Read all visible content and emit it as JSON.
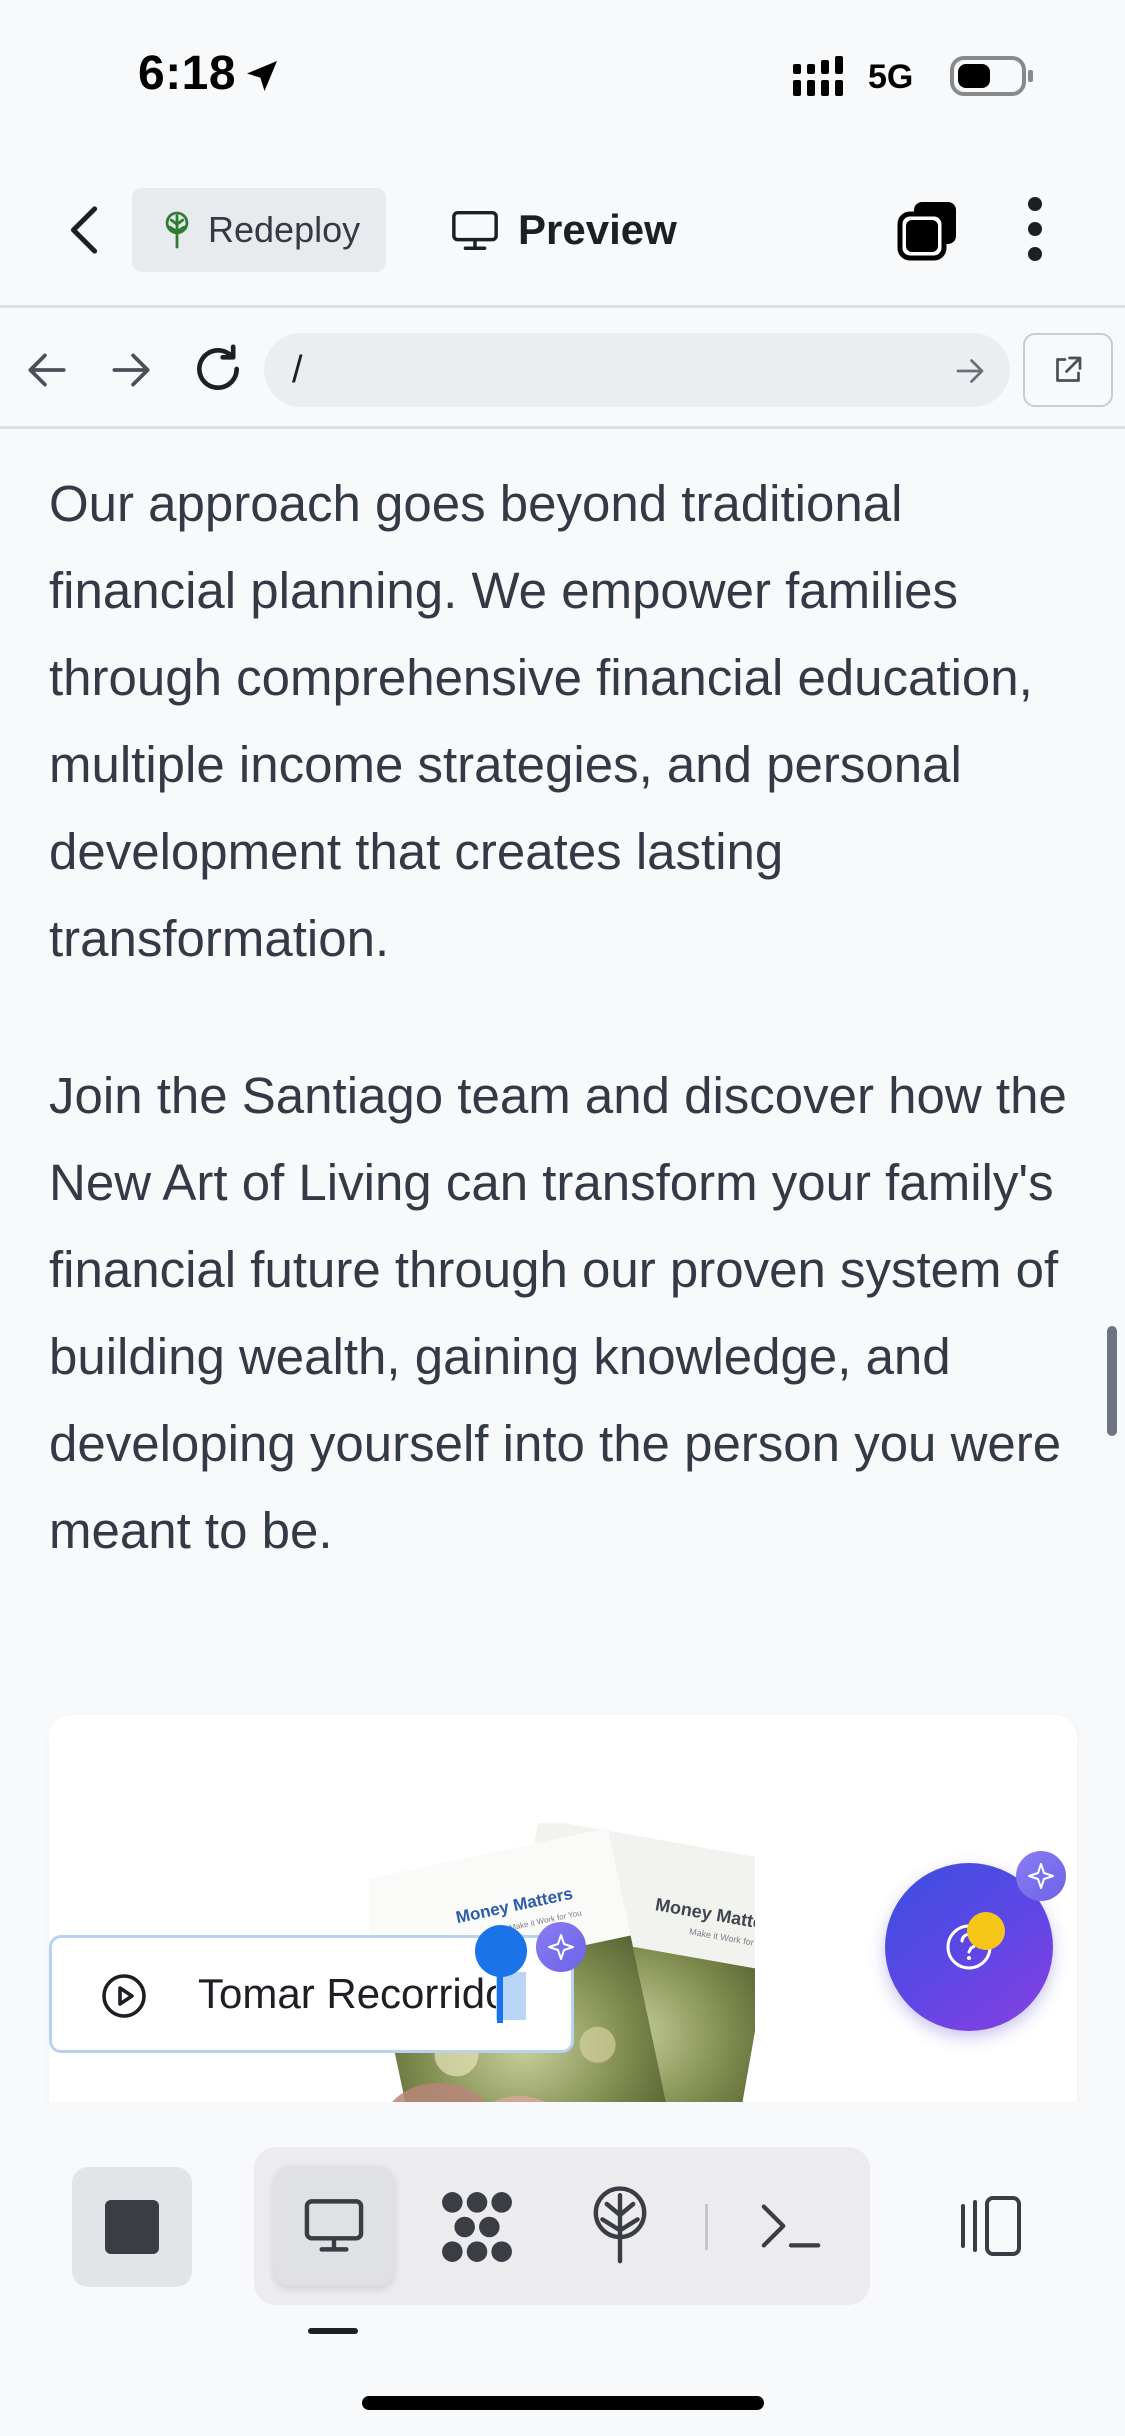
{
  "status": {
    "time": "6:18",
    "network": "5G"
  },
  "header": {
    "redeploy_label": "Redeploy",
    "preview_label": "Preview"
  },
  "urlbar": {
    "url": "/"
  },
  "content": {
    "paragraph1": "Our approach goes beyond traditional financial planning. We empower families through comprehensive financial education, multiple income strategies, and personal development that creates lasting transformation.",
    "paragraph2": "Join the Santiago team and discover how the New Art of Living can transform your family's financial future through our proven system of building wealth, gaining knowledge, and developing yourself into the person you were meant to be.",
    "card_image_title": "Money Matters",
    "card_image_subtitle": "Make it Work for You"
  },
  "recorder": {
    "label": "Tomar Recorrido"
  },
  "bottom_bar": {
    "tools": [
      "desktop",
      "nodes",
      "deploy",
      "terminal"
    ],
    "active_tool": "desktop"
  },
  "colors": {
    "accent": "#1a73e8",
    "fab_gradient_start": "#3b4fe0",
    "fab_gradient_end": "#8a3fe0",
    "redeploy_icon": "#2e7d32"
  }
}
